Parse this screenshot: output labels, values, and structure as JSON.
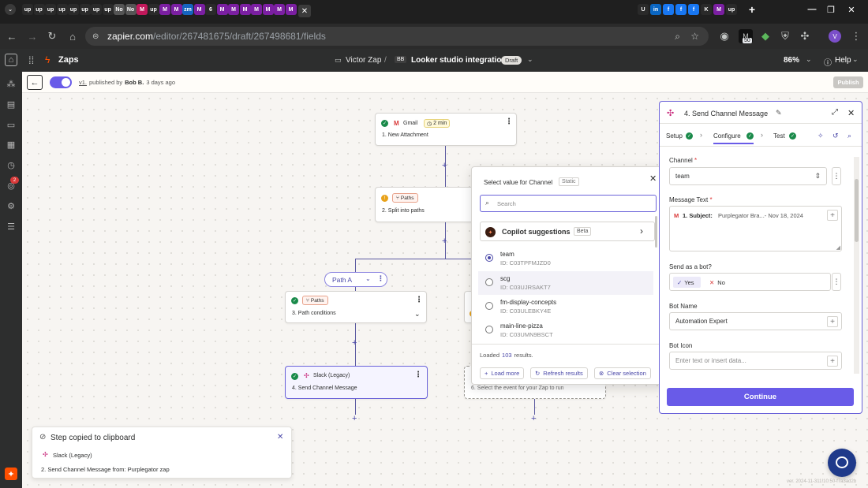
{
  "browser": {
    "tabs": [
      "up",
      "up",
      "up",
      "up",
      "up",
      "up",
      "up",
      "up",
      "No",
      "No",
      "M",
      "up",
      "M",
      "M",
      "zm",
      "M",
      "6",
      "M",
      "M",
      "M",
      "M",
      "M",
      "M",
      "M",
      "U",
      "in",
      "f",
      "f",
      "f",
      "K",
      "M",
      "up"
    ],
    "url_host": "zapier.com",
    "url_path": "/editor/267481675/draft/267498681/fields",
    "extension_badge": "50",
    "profile_initial": "V"
  },
  "appbar": {
    "app_name": "Zaps",
    "folder": "Victor Zap",
    "separator": "/",
    "zap_badge": "BB",
    "zap_title": "Looker studio integration",
    "status": "Draft",
    "zoom": "86%",
    "help": "Help"
  },
  "subbar": {
    "version": "v1.",
    "published_by": "published by",
    "author": "Bob B.",
    "when": "3 days ago",
    "publish_label": "Publish"
  },
  "rail": {
    "notification_count": "2"
  },
  "canvas": {
    "step1": {
      "app": "Gmail",
      "time": "2 min",
      "number": "1.",
      "title": "New Attachment"
    },
    "step2": {
      "tag": "Paths",
      "number": "2.",
      "title": "Split into paths"
    },
    "path_a": {
      "label": "Path A"
    },
    "step3": {
      "tag": "Paths",
      "number": "3.",
      "title": "Path conditions"
    },
    "step4": {
      "app": "Slack (Legacy)",
      "number": "4.",
      "title": "Send Channel Message"
    },
    "step6": {
      "number": "6.",
      "title": "Select the event for your Zap to run"
    }
  },
  "popup": {
    "title": "Select value for Channel",
    "static_badge": "Static",
    "search_placeholder": "Search",
    "copilot": "Copilot suggestions",
    "beta": "Beta",
    "options": [
      {
        "name": "team",
        "id": "ID: C03TPFMJZD0",
        "selected": true
      },
      {
        "name": "scg",
        "id": "ID: C03UJRSAKT7",
        "selected": false
      },
      {
        "name": "fm-display-concepts",
        "id": "ID: C03ULEBKY4E",
        "selected": false
      },
      {
        "name": "main-line-pizza",
        "id": "ID: C03UMN9BSCT",
        "selected": false
      }
    ],
    "loaded_prefix": "Loaded",
    "loaded_count": "103",
    "loaded_suffix": "results.",
    "load_more": "Load more",
    "refresh": "Refresh results",
    "clear": "Clear selection"
  },
  "panel": {
    "title": "4. Send Channel Message",
    "tabs": [
      "Setup",
      "Configure",
      "Test"
    ],
    "channel_label": "Channel",
    "channel_value": "team",
    "message_label": "Message Text",
    "message_pill": "1. Subject:",
    "message_value": "Purplegator Bra...- Nov 18, 2024",
    "bot_label": "Send as a bot?",
    "yes": "Yes",
    "no": "No",
    "bot_name_label": "Bot Name",
    "bot_name_value": "Automation Expert",
    "bot_icon_label": "Bot Icon",
    "bot_icon_placeholder": "Enter text or insert data...",
    "continue": "Continue"
  },
  "toast": {
    "title": "Step copied to clipboard",
    "app": "Slack (Legacy)",
    "number": "2.",
    "text": "Send Channel Message from: Purplegator zap"
  },
  "footer": {
    "version_text": "ver. 2024-11-311!10:50-f7a3ad2b"
  },
  "colors": {
    "accent": "#695be8",
    "brand_orange": "#ff4f00",
    "success": "#1a8a4a"
  }
}
